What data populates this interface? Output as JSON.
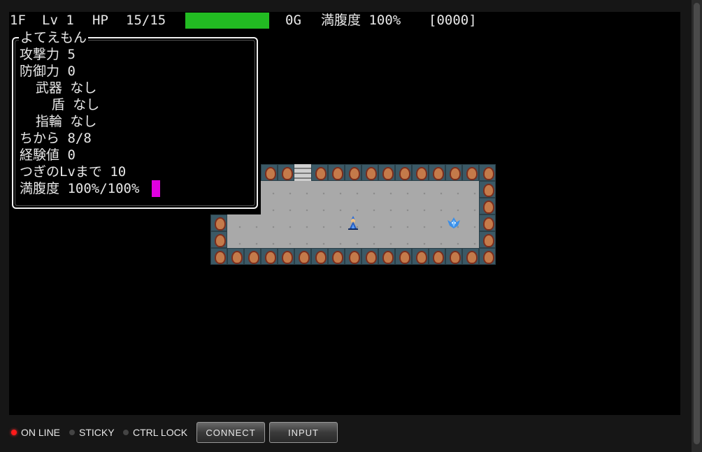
{
  "status_bar": {
    "floor": "1F",
    "level": "Lv 1",
    "hp_label": "HP",
    "hp_value": "15/15",
    "hp_fraction": 1.0,
    "gold": "0G",
    "fullness": "満腹度 100%",
    "turns": "[0000]"
  },
  "character": {
    "name": "よてえもん",
    "lines": [
      "攻撃力 5",
      "防御力 0",
      "  武器 なし",
      "    盾 なし",
      "  指輪 なし",
      "ちから 8/8",
      "経験値 0",
      "つぎのLvまで 10",
      "満腹度 100%/100%"
    ]
  },
  "colors": {
    "hp_bar": "#22bb22",
    "cursor": "#e000e0",
    "online_led": "#ff1a1a"
  },
  "controls": {
    "online": "ON LINE",
    "sticky": "STICKY",
    "ctrl_lock": "CTRL LOCK",
    "connect": "CONNECT",
    "input": "INPUT"
  },
  "icons": {
    "hero": "hero-icon",
    "monster": "monster-icon",
    "stairs": "stairs-icon"
  }
}
